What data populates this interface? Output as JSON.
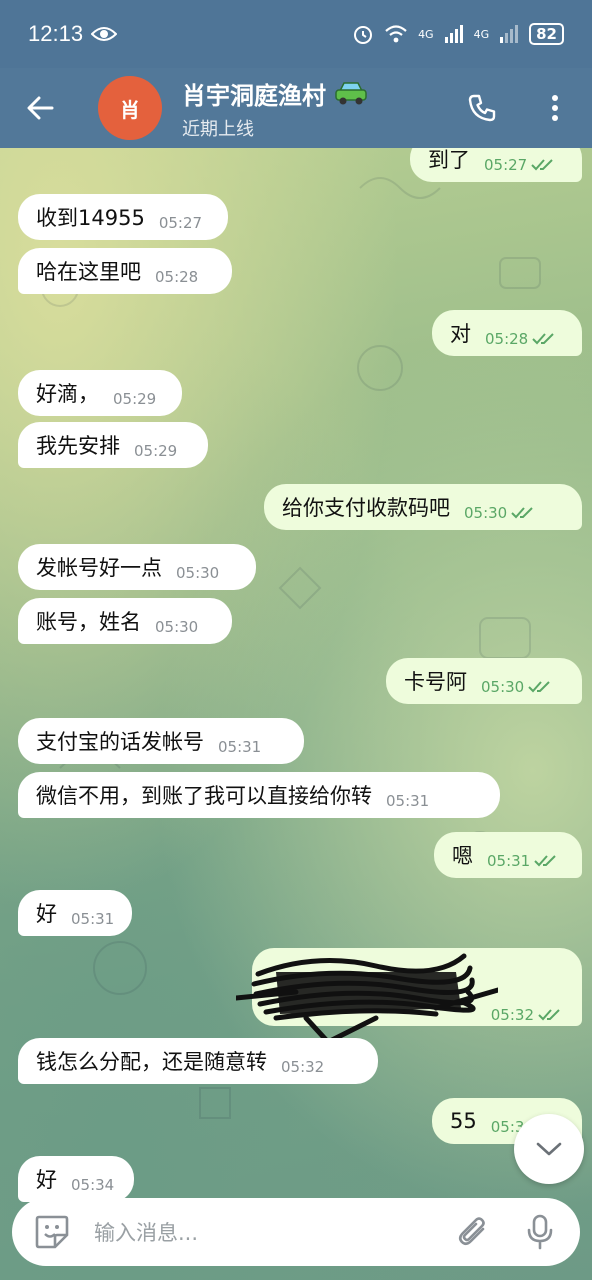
{
  "status": {
    "time": "12:13",
    "battery": "82",
    "net1": "4G",
    "net2": "4G"
  },
  "header": {
    "avatar_letter": "肖",
    "title": "肖宇洞庭渔村",
    "subtitle": "近期上线"
  },
  "input": {
    "placeholder": "输入消息..."
  },
  "colors": {
    "header": "#527899",
    "outgoing_bubble": "#eefcdc",
    "incoming_bubble": "#ffffff",
    "check": "#5aa766",
    "avatar": "#e4613d"
  },
  "messages": [
    {
      "side": "out",
      "text": "到了",
      "time": "05:27",
      "read": true
    },
    {
      "side": "in",
      "text": "收到14955",
      "time": "05:27"
    },
    {
      "side": "in",
      "text": "哈在这里吧",
      "time": "05:28"
    },
    {
      "side": "out",
      "text": "对",
      "time": "05:28",
      "read": true
    },
    {
      "side": "in",
      "text": "好滴，",
      "time": "05:29"
    },
    {
      "side": "in",
      "text": "我先安排",
      "time": "05:29"
    },
    {
      "side": "out",
      "text": "给你支付收款码吧",
      "time": "05:30",
      "read": true
    },
    {
      "side": "in",
      "text": "发帐号好一点",
      "time": "05:30"
    },
    {
      "side": "in",
      "text": "账号，姓名",
      "time": "05:30"
    },
    {
      "side": "out",
      "text": "卡号阿",
      "time": "05:30",
      "read": true
    },
    {
      "side": "in",
      "text": "支付宝的话发帐号",
      "time": "05:31"
    },
    {
      "side": "in",
      "text": "微信不用，到账了我可以直接给你转",
      "time": "05:31"
    },
    {
      "side": "out",
      "text": "嗯",
      "time": "05:31",
      "read": true
    },
    {
      "side": "in",
      "text": "好",
      "time": "05:31"
    },
    {
      "side": "out",
      "text": "",
      "time": "05:32",
      "read": true,
      "redacted": true
    },
    {
      "side": "in",
      "text": "钱怎么分配，还是随意转",
      "time": "05:32"
    },
    {
      "side": "out",
      "text": "55",
      "time": "05:3"
    },
    {
      "side": "in",
      "text": "好",
      "time": "05:34"
    }
  ]
}
